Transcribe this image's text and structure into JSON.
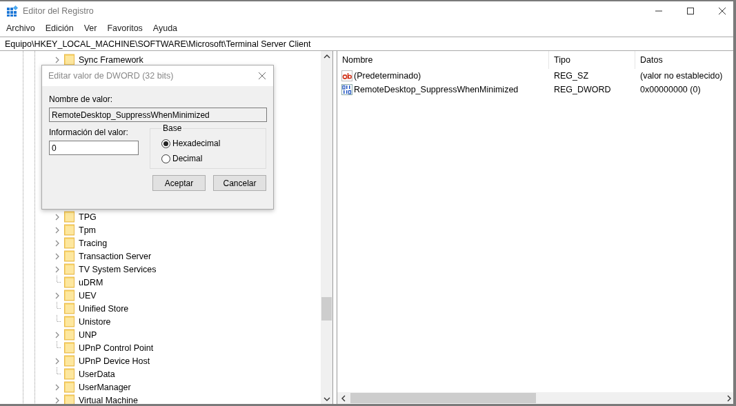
{
  "window": {
    "title": "Editor del Registro"
  },
  "menu": [
    "Archivo",
    "Edición",
    "Ver",
    "Favoritos",
    "Ayuda"
  ],
  "address_bar": {
    "value": "Equipo\\HKEY_LOCAL_MACHINE\\SOFTWARE\\Microsoft\\Terminal Server Client"
  },
  "tree": {
    "top_items": [
      {
        "label": "Sync Framework",
        "kind": "expandable"
      }
    ],
    "lower_items": [
      {
        "label": "TPG",
        "kind": "expandable"
      },
      {
        "label": "Tpm",
        "kind": "expandable"
      },
      {
        "label": "Tracing",
        "kind": "expandable"
      },
      {
        "label": "Transaction Server",
        "kind": "expandable"
      },
      {
        "label": "TV System Services",
        "kind": "expandable"
      },
      {
        "label": "uDRM",
        "kind": "leaf"
      },
      {
        "label": "UEV",
        "kind": "expandable"
      },
      {
        "label": "Unified Store",
        "kind": "leaf"
      },
      {
        "label": "Unistore",
        "kind": "leaf"
      },
      {
        "label": "UNP",
        "kind": "expandable"
      },
      {
        "label": "UPnP Control Point",
        "kind": "leaf"
      },
      {
        "label": "UPnP Device Host",
        "kind": "expandable"
      },
      {
        "label": "UserData",
        "kind": "leaf"
      },
      {
        "label": "UserManager",
        "kind": "expandable"
      },
      {
        "label": "Virtual Machine",
        "kind": "expandable"
      }
    ]
  },
  "values_table": {
    "columns": [
      "Nombre",
      "Tipo",
      "Datos"
    ],
    "rows": [
      {
        "kind": "string",
        "name": "(Predeterminado)",
        "type": "REG_SZ",
        "data": "(valor no establecido)"
      },
      {
        "kind": "binary",
        "name": "RemoteDesktop_SuppressWhenMinimized",
        "type": "REG_DWORD",
        "data": "0x00000000 (0)"
      }
    ]
  },
  "dialog": {
    "title": "Editar valor de DWORD (32 bits)",
    "name_label": "Nombre de valor:",
    "name_value": "RemoteDesktop_SuppressWhenMinimized",
    "data_label": "Información del valor:",
    "data_value": "0",
    "base_label": "Base",
    "radios": [
      {
        "label": "Hexadecimal",
        "selected": true
      },
      {
        "label": "Decimal",
        "selected": false
      }
    ],
    "buttons": [
      "Aceptar",
      "Cancelar"
    ]
  }
}
